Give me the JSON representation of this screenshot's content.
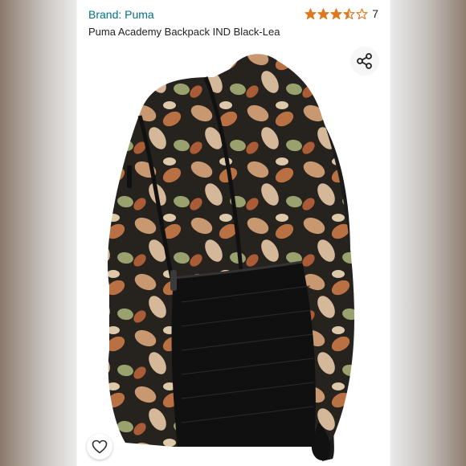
{
  "product": {
    "brand_label": "Brand: Puma",
    "title": "Puma Academy Backpack IND Black-Lea",
    "rating": 3.5,
    "rating_max": 5,
    "review_count": "7",
    "image_alt": "backpack-photo"
  },
  "colors": {
    "brand_link": "#007185",
    "star_fill": "#de7921",
    "star_outline": "#de7921"
  },
  "icons": {
    "share": "share-icon",
    "favorite": "heart-icon"
  }
}
